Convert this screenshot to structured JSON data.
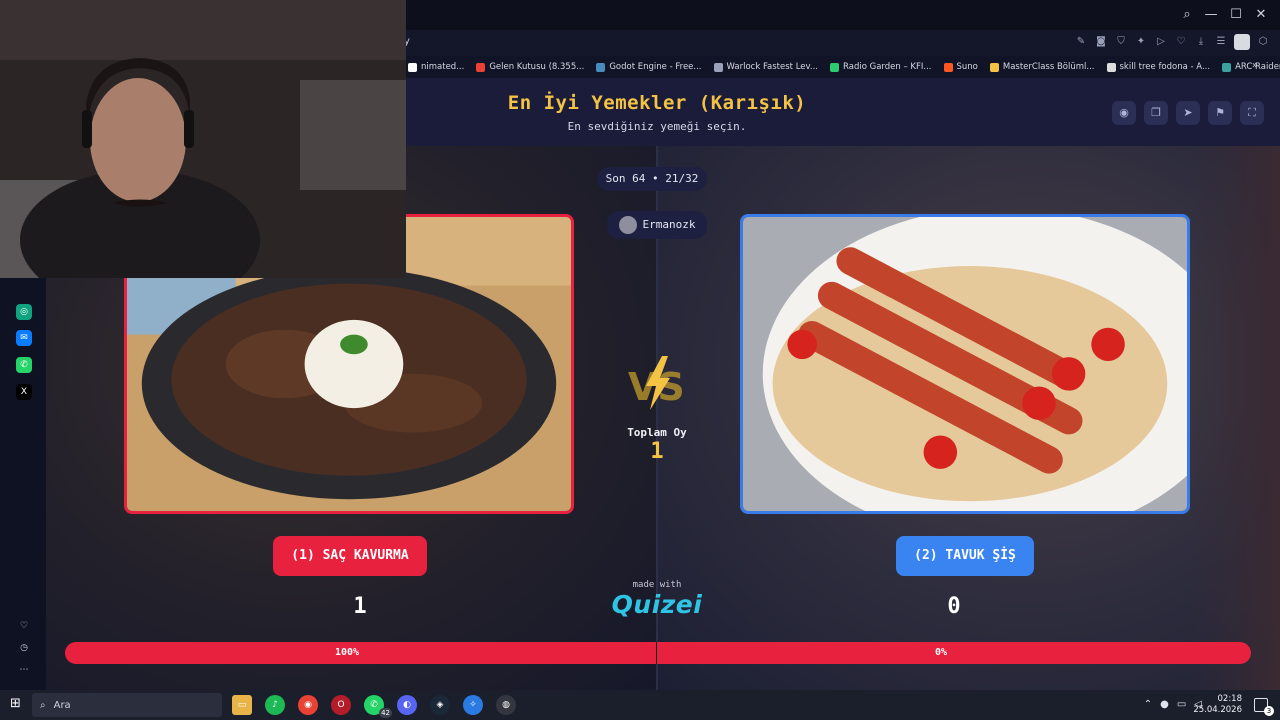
{
  "browser": {
    "url_fragment": "y",
    "window_controls": {
      "search": "⌕",
      "minimize": "—",
      "maximize": "☐",
      "close": "✕"
    },
    "bookmarks": [
      {
        "label": "nimated...",
        "color": "#ffffff"
      },
      {
        "label": "Gelen Kutusu (8.355...",
        "color": "#ea4335"
      },
      {
        "label": "Godot Engine - Free...",
        "color": "#478cbf"
      },
      {
        "label": "Warlock Fastest Lev...",
        "color": "#9aa0b8"
      },
      {
        "label": "Radio Garden – KFI...",
        "color": "#2ecc71"
      },
      {
        "label": "Suno",
        "color": "#ff5722"
      },
      {
        "label": "MasterClass Bölüml...",
        "color": "#f5c344"
      },
      {
        "label": "skill tree fodona - A...",
        "color": "#dddddd"
      },
      {
        "label": "ARC Raiders Anvil Bl...",
        "color": "#3aa0a0"
      }
    ],
    "bookmarks_more": "»"
  },
  "quiz": {
    "title": "En İyi Yemekler (Karışık)",
    "subtitle": "En sevdiğiniz yemeği seçin.",
    "round": "Son 64 • 21/32",
    "user": "Ermanozk",
    "total_label": "Toplam Oy",
    "total_value": "1",
    "left": {
      "label": "(1) SAÇ KAVURMA",
      "votes": "1",
      "percent_label": "100%",
      "percent": 100
    },
    "right": {
      "label": "(2) TAVUK ŞİŞ",
      "votes": "0",
      "percent_label": "0%",
      "percent": 0
    },
    "made_with": "made with",
    "brand": "Quizei",
    "colors": {
      "left": "#e8213f",
      "right": "#3a84f2",
      "title": "#f5c344",
      "brand": "#2fc4e3"
    }
  },
  "taskbar": {
    "search_placeholder": "Ara",
    "whatsapp_badge": "42",
    "time": "02:18",
    "date": "25.04.2026",
    "notifications": "3"
  }
}
